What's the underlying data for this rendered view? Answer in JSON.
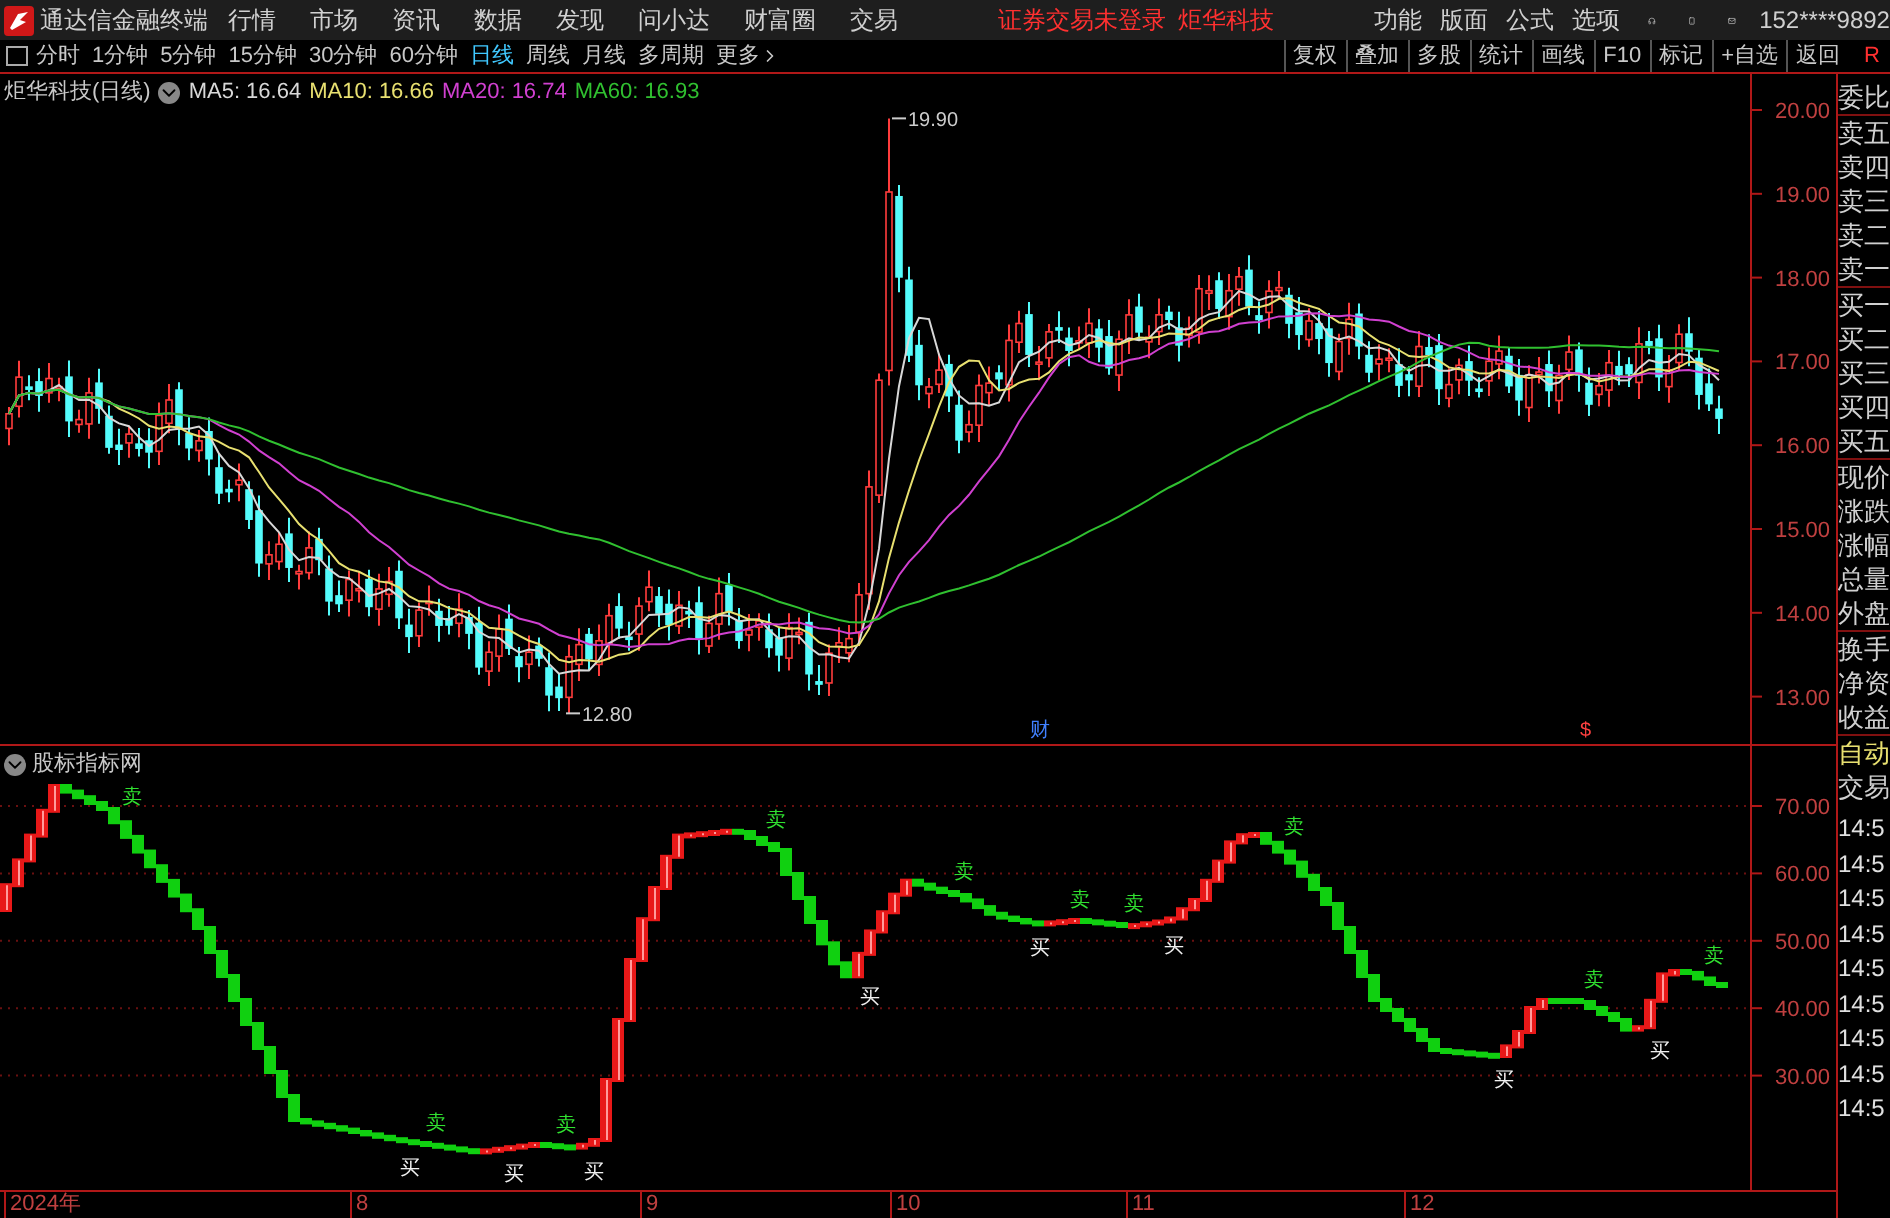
{
  "menu_bar": {
    "app_title": "通达信金融终端",
    "menus": [
      "行情",
      "市场",
      "资讯",
      "数据",
      "发现",
      "问小达",
      "财富圈",
      "交易"
    ],
    "notice": "证券交易未登录",
    "stock": "炬华科技",
    "right_menus": [
      "功能",
      "版面",
      "公式",
      "选项"
    ],
    "account": "152****9892"
  },
  "toolbar": {
    "periods": [
      {
        "label": "分时",
        "selected": false
      },
      {
        "label": "1分钟",
        "selected": false
      },
      {
        "label": "5分钟",
        "selected": false
      },
      {
        "label": "15分钟",
        "selected": false
      },
      {
        "label": "30分钟",
        "selected": false
      },
      {
        "label": "60分钟",
        "selected": false
      },
      {
        "label": "日线",
        "selected": true
      },
      {
        "label": "周线",
        "selected": false
      },
      {
        "label": "月线",
        "selected": false
      },
      {
        "label": "多周期",
        "selected": false
      },
      {
        "label": "更多",
        "selected": false
      }
    ],
    "buttons": [
      "复权",
      "叠加",
      "多股",
      "统计",
      "画线",
      "F10",
      "标记",
      "+自选",
      "返回"
    ],
    "side_label": "R"
  },
  "price_chart": {
    "title": "炬华科技(日线)",
    "indicators": [
      {
        "label": "MA5: 16.64",
        "color": "#d8d8d8"
      },
      {
        "label": "MA10: 16.66",
        "color": "#e8e070"
      },
      {
        "label": "MA20: 16.74",
        "color": "#d040d0"
      },
      {
        "label": "MA60: 16.93",
        "color": "#30c030"
      }
    ],
    "high_label": "19.90",
    "low_label": "12.80",
    "markers": [
      {
        "text": "财",
        "kind": "finance"
      },
      {
        "text": "$",
        "kind": "dividend"
      }
    ],
    "axis_labels": [
      "20.00",
      "19.00",
      "18.00",
      "17.00",
      "16.00",
      "15.00",
      "14.00",
      "13.00"
    ]
  },
  "indicator_chart": {
    "title": "股标指标网",
    "axis_labels": [
      "70.00",
      "60.00",
      "50.00",
      "40.00",
      "30.00"
    ],
    "signals": [
      {
        "text": "卖",
        "kind": "sell"
      },
      {
        "text": "买",
        "kind": "buy"
      },
      {
        "text": "卖",
        "kind": "sell"
      },
      {
        "text": "买",
        "kind": "buy"
      },
      {
        "text": "卖",
        "kind": "sell"
      },
      {
        "text": "买",
        "kind": "buy"
      },
      {
        "text": "卖",
        "kind": "sell"
      },
      {
        "text": "买",
        "kind": "buy"
      },
      {
        "text": "卖",
        "kind": "sell"
      },
      {
        "text": "买",
        "kind": "buy"
      },
      {
        "text": "卖",
        "kind": "sell"
      },
      {
        "text": "卖",
        "kind": "sell"
      },
      {
        "text": "买",
        "kind": "buy"
      },
      {
        "text": "卖",
        "kind": "sell"
      },
      {
        "text": "买",
        "kind": "buy"
      },
      {
        "text": "卖",
        "kind": "sell"
      },
      {
        "text": "买",
        "kind": "buy"
      },
      {
        "text": "卖",
        "kind": "sell"
      }
    ]
  },
  "date_axis": [
    "2024年",
    "8",
    "9",
    "10",
    "11",
    "12"
  ],
  "quote_panel": {
    "sections": [
      [
        "委比"
      ],
      [
        "卖五",
        "卖四",
        "卖三",
        "卖二",
        "卖一"
      ],
      [
        "买一",
        "买二",
        "买三",
        "买四",
        "买五"
      ],
      [
        "现价",
        "涨跌",
        "涨幅",
        "总量",
        "外盘"
      ],
      [
        "换手",
        "净资",
        "收益"
      ]
    ],
    "modes": [
      {
        "text": "自动",
        "kind": "active"
      },
      {
        "text": "交易",
        "kind": "plain"
      }
    ],
    "times": [
      "14:5",
      "14:5",
      "14:5",
      "14:5",
      "14:5",
      "14:5",
      "14:5",
      "14:5",
      "14:5"
    ]
  }
}
